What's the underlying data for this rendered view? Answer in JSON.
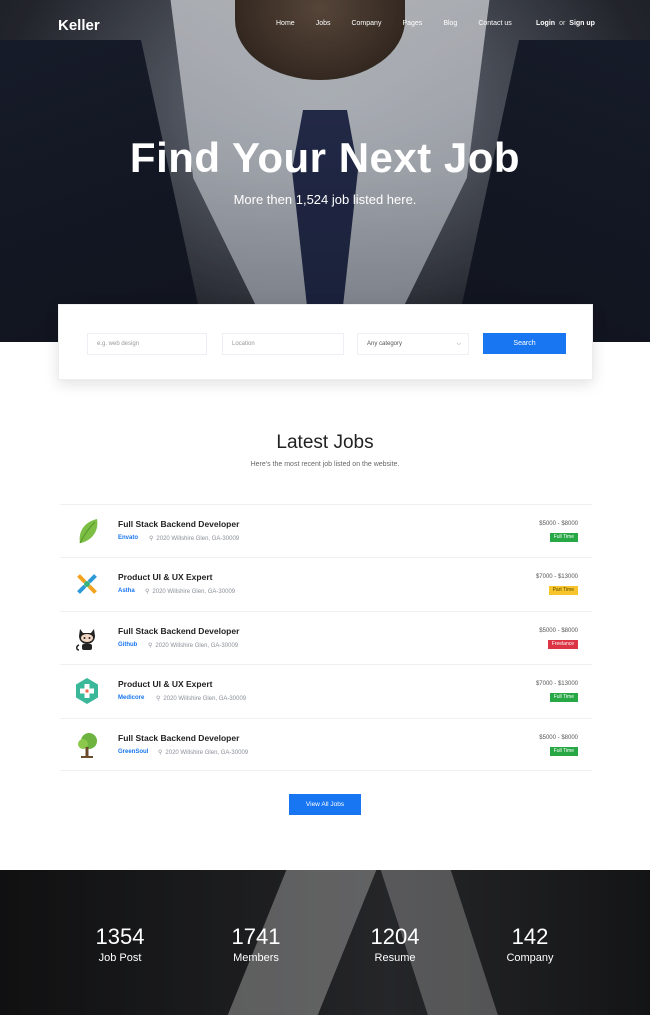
{
  "nav": {
    "logo": "Keller",
    "links": [
      "Home",
      "Jobs",
      "Company",
      "Pages",
      "Blog",
      "Contact us"
    ],
    "login": "Login",
    "or": "or",
    "signup": "Sign up"
  },
  "hero": {
    "title": "Find Your Next Job",
    "subtitle": "More then 1,524 job listed here."
  },
  "search": {
    "keyword_placeholder": "e.g. web design",
    "location_placeholder": "Location",
    "category_value": "Any category",
    "button": "Search"
  },
  "latest": {
    "title": "Latest Jobs",
    "subtitle": "Here's the most recent job listed on the website."
  },
  "jobs": [
    {
      "title": "Full Stack Backend Developer",
      "company": "Envato",
      "location": "2020 Willshire Glen, GA-30009",
      "salary": "$5000 - $8000",
      "type": "Full Time",
      "badge_color": "#28a745",
      "logo_icon": "leaf-logo-icon"
    },
    {
      "title": "Product UI & UX Expert",
      "company": "Astha",
      "location": "2020 Willshire Glen, GA-30009",
      "salary": "$7000 - $13000",
      "type": "Part Time",
      "badge_color": "#f7c52b",
      "logo_icon": "cross-arrows-logo-icon"
    },
    {
      "title": "Full Stack Backend Developer",
      "company": "Github",
      "location": "2020 Willshire Glen, GA-30009",
      "salary": "$5000 - $8000",
      "type": "Freelance",
      "badge_color": "#dc3545",
      "logo_icon": "octocat-logo-icon"
    },
    {
      "title": "Product UI & UX Expert",
      "company": "Medicore",
      "location": "2020 Willshire Glen, GA-30009",
      "salary": "$7000 - $13000",
      "type": "Full Time",
      "badge_color": "#28a745",
      "logo_icon": "medical-cross-logo-icon"
    },
    {
      "title": "Full Stack Backend Developer",
      "company": "GreenSoul",
      "location": "2020 Willshire Glen, GA-30009",
      "salary": "$5000 - $8000",
      "type": "Full Time",
      "badge_color": "#28a745",
      "logo_icon": "tree-logo-icon"
    }
  ],
  "view_all": "View All Jobs",
  "stats": [
    {
      "number": "1354",
      "label": "Job Post"
    },
    {
      "number": "1741",
      "label": "Members"
    },
    {
      "number": "1204",
      "label": "Resume"
    },
    {
      "number": "142",
      "label": "Company"
    }
  ],
  "colors": {
    "primary": "#1876f2",
    "text": "#222222",
    "muted": "#8a8f98"
  }
}
